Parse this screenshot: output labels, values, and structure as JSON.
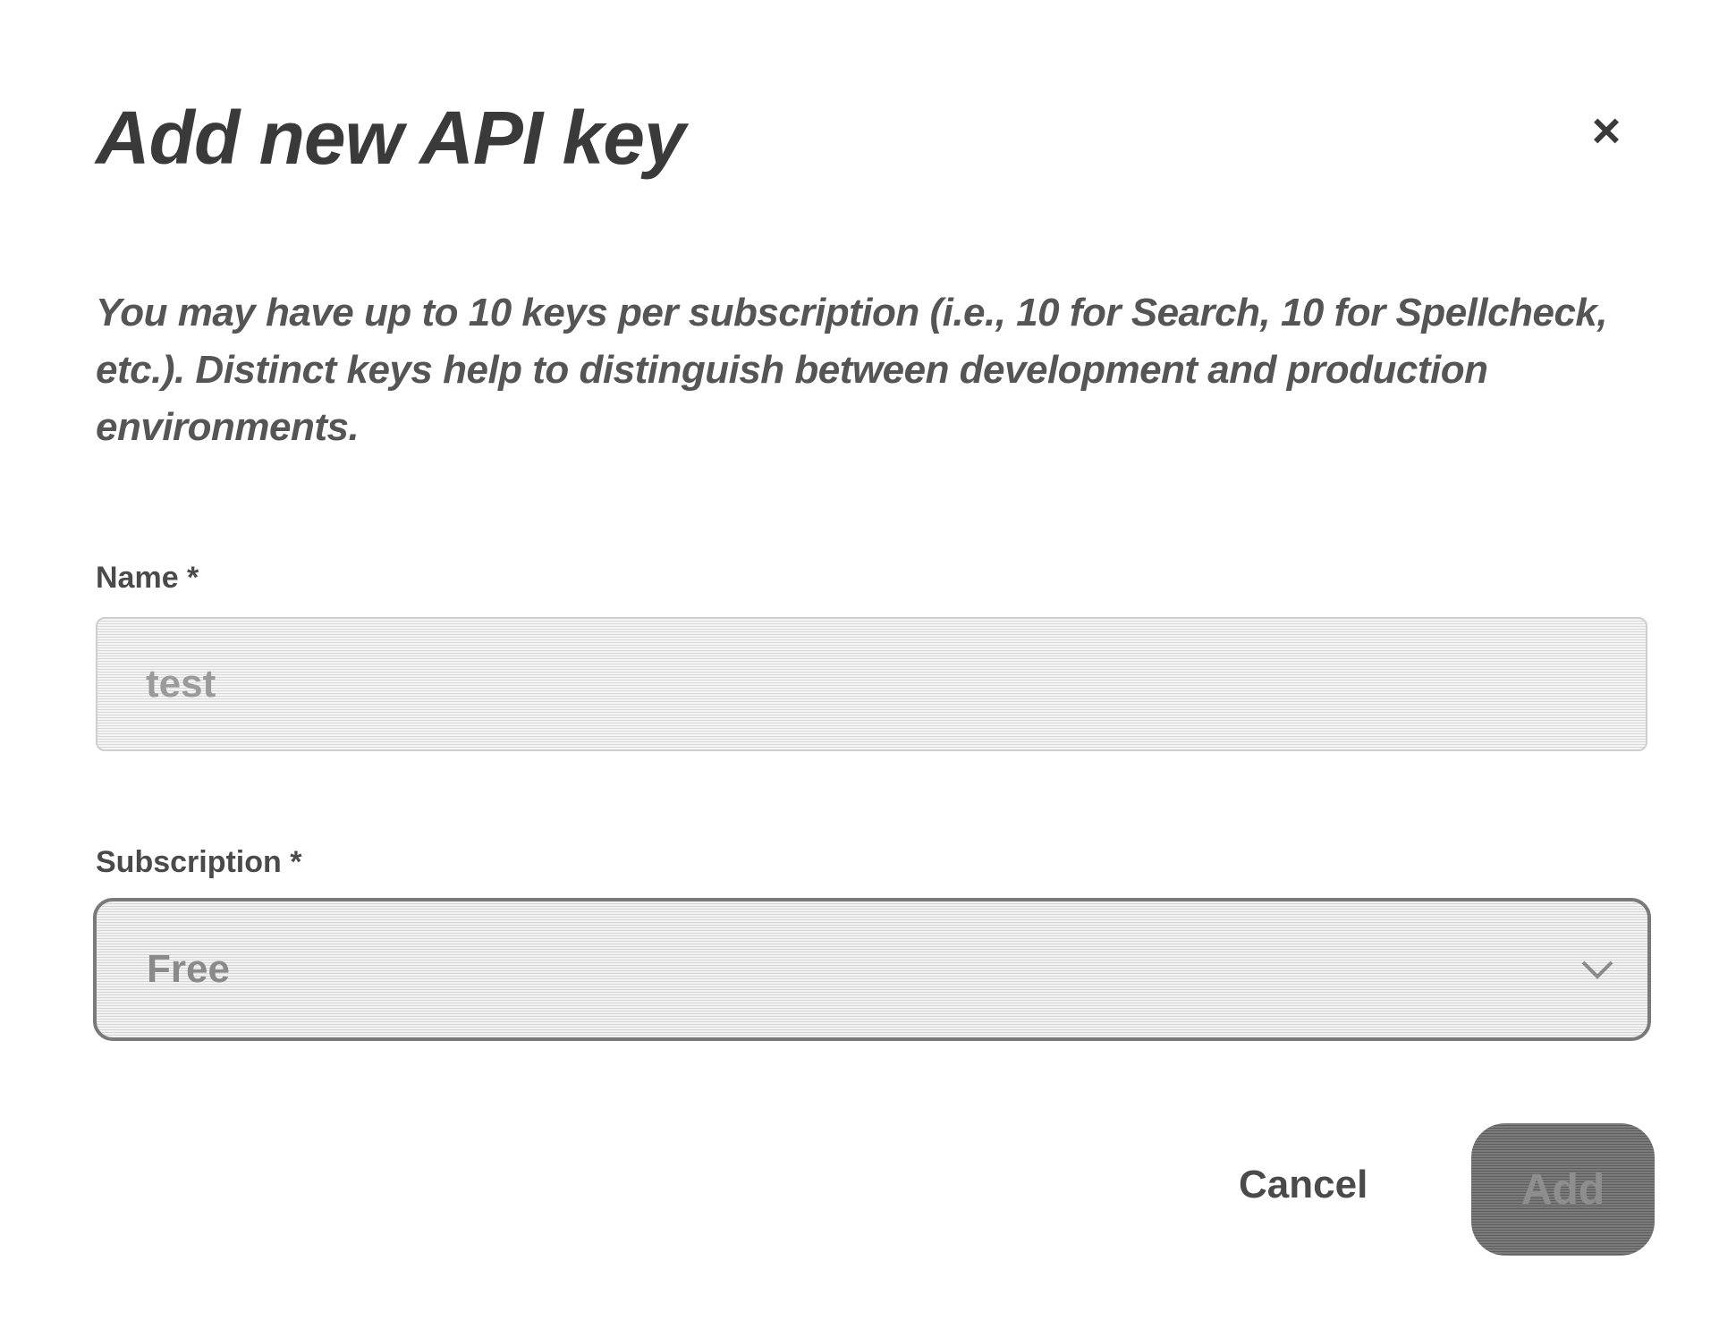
{
  "dialog": {
    "title": "Add new API key",
    "close_label": "×",
    "description": "You may have up to 10 keys per subscription (i.e., 10 for Search, 10 for Spellcheck, etc.). Distinct keys help to distinguish between development and production environments."
  },
  "form": {
    "name": {
      "label": "Name *",
      "placeholder": "test",
      "value": ""
    },
    "subscription": {
      "label": "Subscription *",
      "selected": "Free",
      "chevron_icon": "chevron-down-icon"
    }
  },
  "actions": {
    "cancel_label": "Cancel",
    "add_label": "Add"
  },
  "colors": {
    "primary_button": "#666666",
    "text": "#333333",
    "border": "#7a7a7a"
  }
}
